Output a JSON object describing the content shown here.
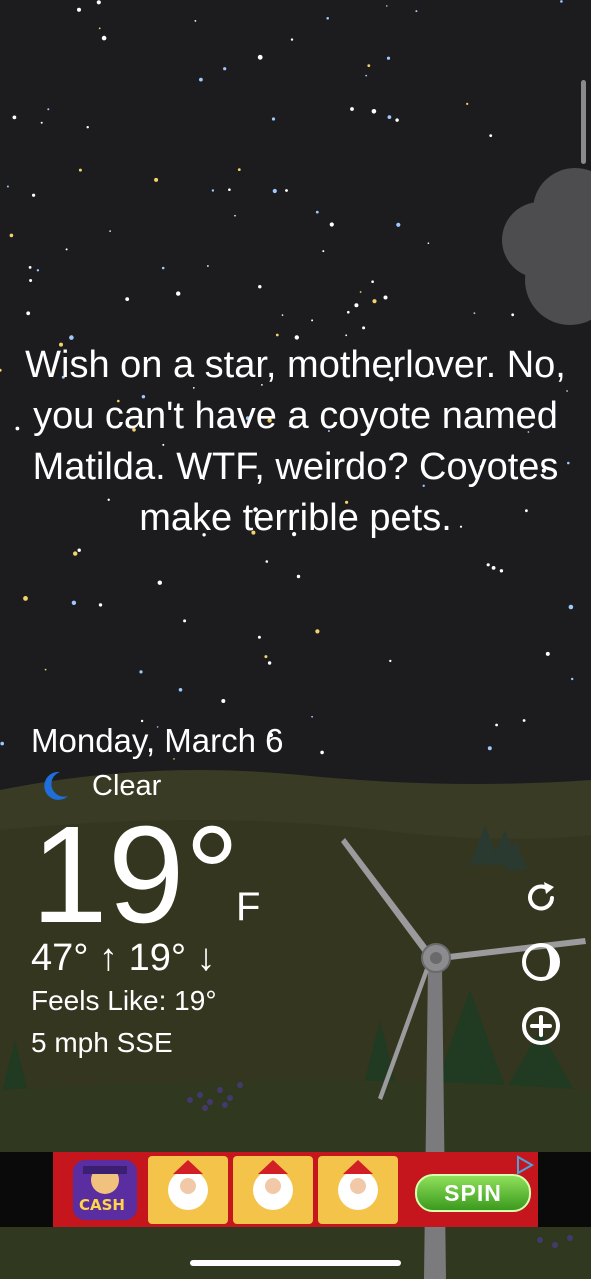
{
  "quote": "Wish on a star, motherlover. No, you can't have a coyote named Matilda. WTF, weirdo? Coyotes make terrible pets.",
  "weather": {
    "date": "Monday, March 6",
    "condition": "Clear",
    "condition_icon": "moon-icon",
    "temperature": "19°",
    "unit": "F",
    "hi_lo": "47° ↑ 19° ↓",
    "feels_like": "Feels Like: 19°",
    "wind": "5 mph SSE"
  },
  "controls": [
    {
      "name": "refresh-icon"
    },
    {
      "name": "moon-phase-icon"
    },
    {
      "name": "add-location-icon"
    }
  ],
  "ad": {
    "logo_text": "CASH",
    "cta": "SPIN"
  },
  "colors": {
    "sky": "#1c1c1e",
    "hills": "#3b3c26",
    "ad_red": "#c4161c",
    "spin_green": "#56b52b",
    "moon_blue": "#1e6fd9"
  }
}
